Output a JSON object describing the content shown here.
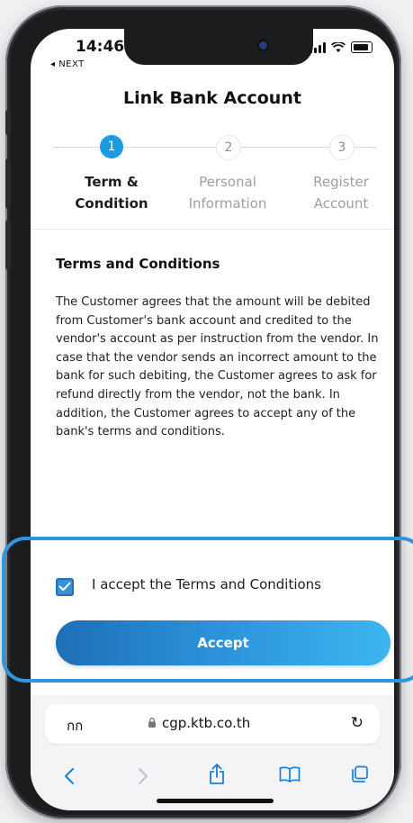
{
  "status": {
    "time": "14:46",
    "back_label": "◂ NEXT"
  },
  "header": {
    "title": "Link Bank Account"
  },
  "stepper": {
    "steps": [
      {
        "number": "1",
        "line1": "Term &",
        "line2": "Condition",
        "active": true
      },
      {
        "number": "2",
        "line1": "Personal",
        "line2": "Information",
        "active": false
      },
      {
        "number": "3",
        "line1": "Register",
        "line2": "Account",
        "active": false
      }
    ]
  },
  "content": {
    "section_title": "Terms and Conditions",
    "body": "The Customer agrees that the amount will be debited from Customer's bank account and credited to the vendor's account as per instruction from the vendor. In case that the vendor sends an incorrect amount to the bank for such debiting, the Customer agrees to ask for refund directly from the vendor, not the bank. In addition, the Customer agrees to accept any of the bank's terms and conditions."
  },
  "consent": {
    "checkbox_checked": true,
    "label": "I accept the Terms and Conditions"
  },
  "actions": {
    "accept_label": "Accept"
  },
  "browser": {
    "aa_label": "กก",
    "url": "cgp.ktb.co.th",
    "icons": [
      "back-icon",
      "forward-icon",
      "share-icon",
      "bookmarks-icon",
      "tabs-icon",
      "lock-icon",
      "reload-icon"
    ]
  },
  "colors": {
    "accent": "#1a9ae0",
    "button_start": "#1f6fb6",
    "button_end": "#3cb6ef",
    "highlight": "#2f95dc"
  }
}
